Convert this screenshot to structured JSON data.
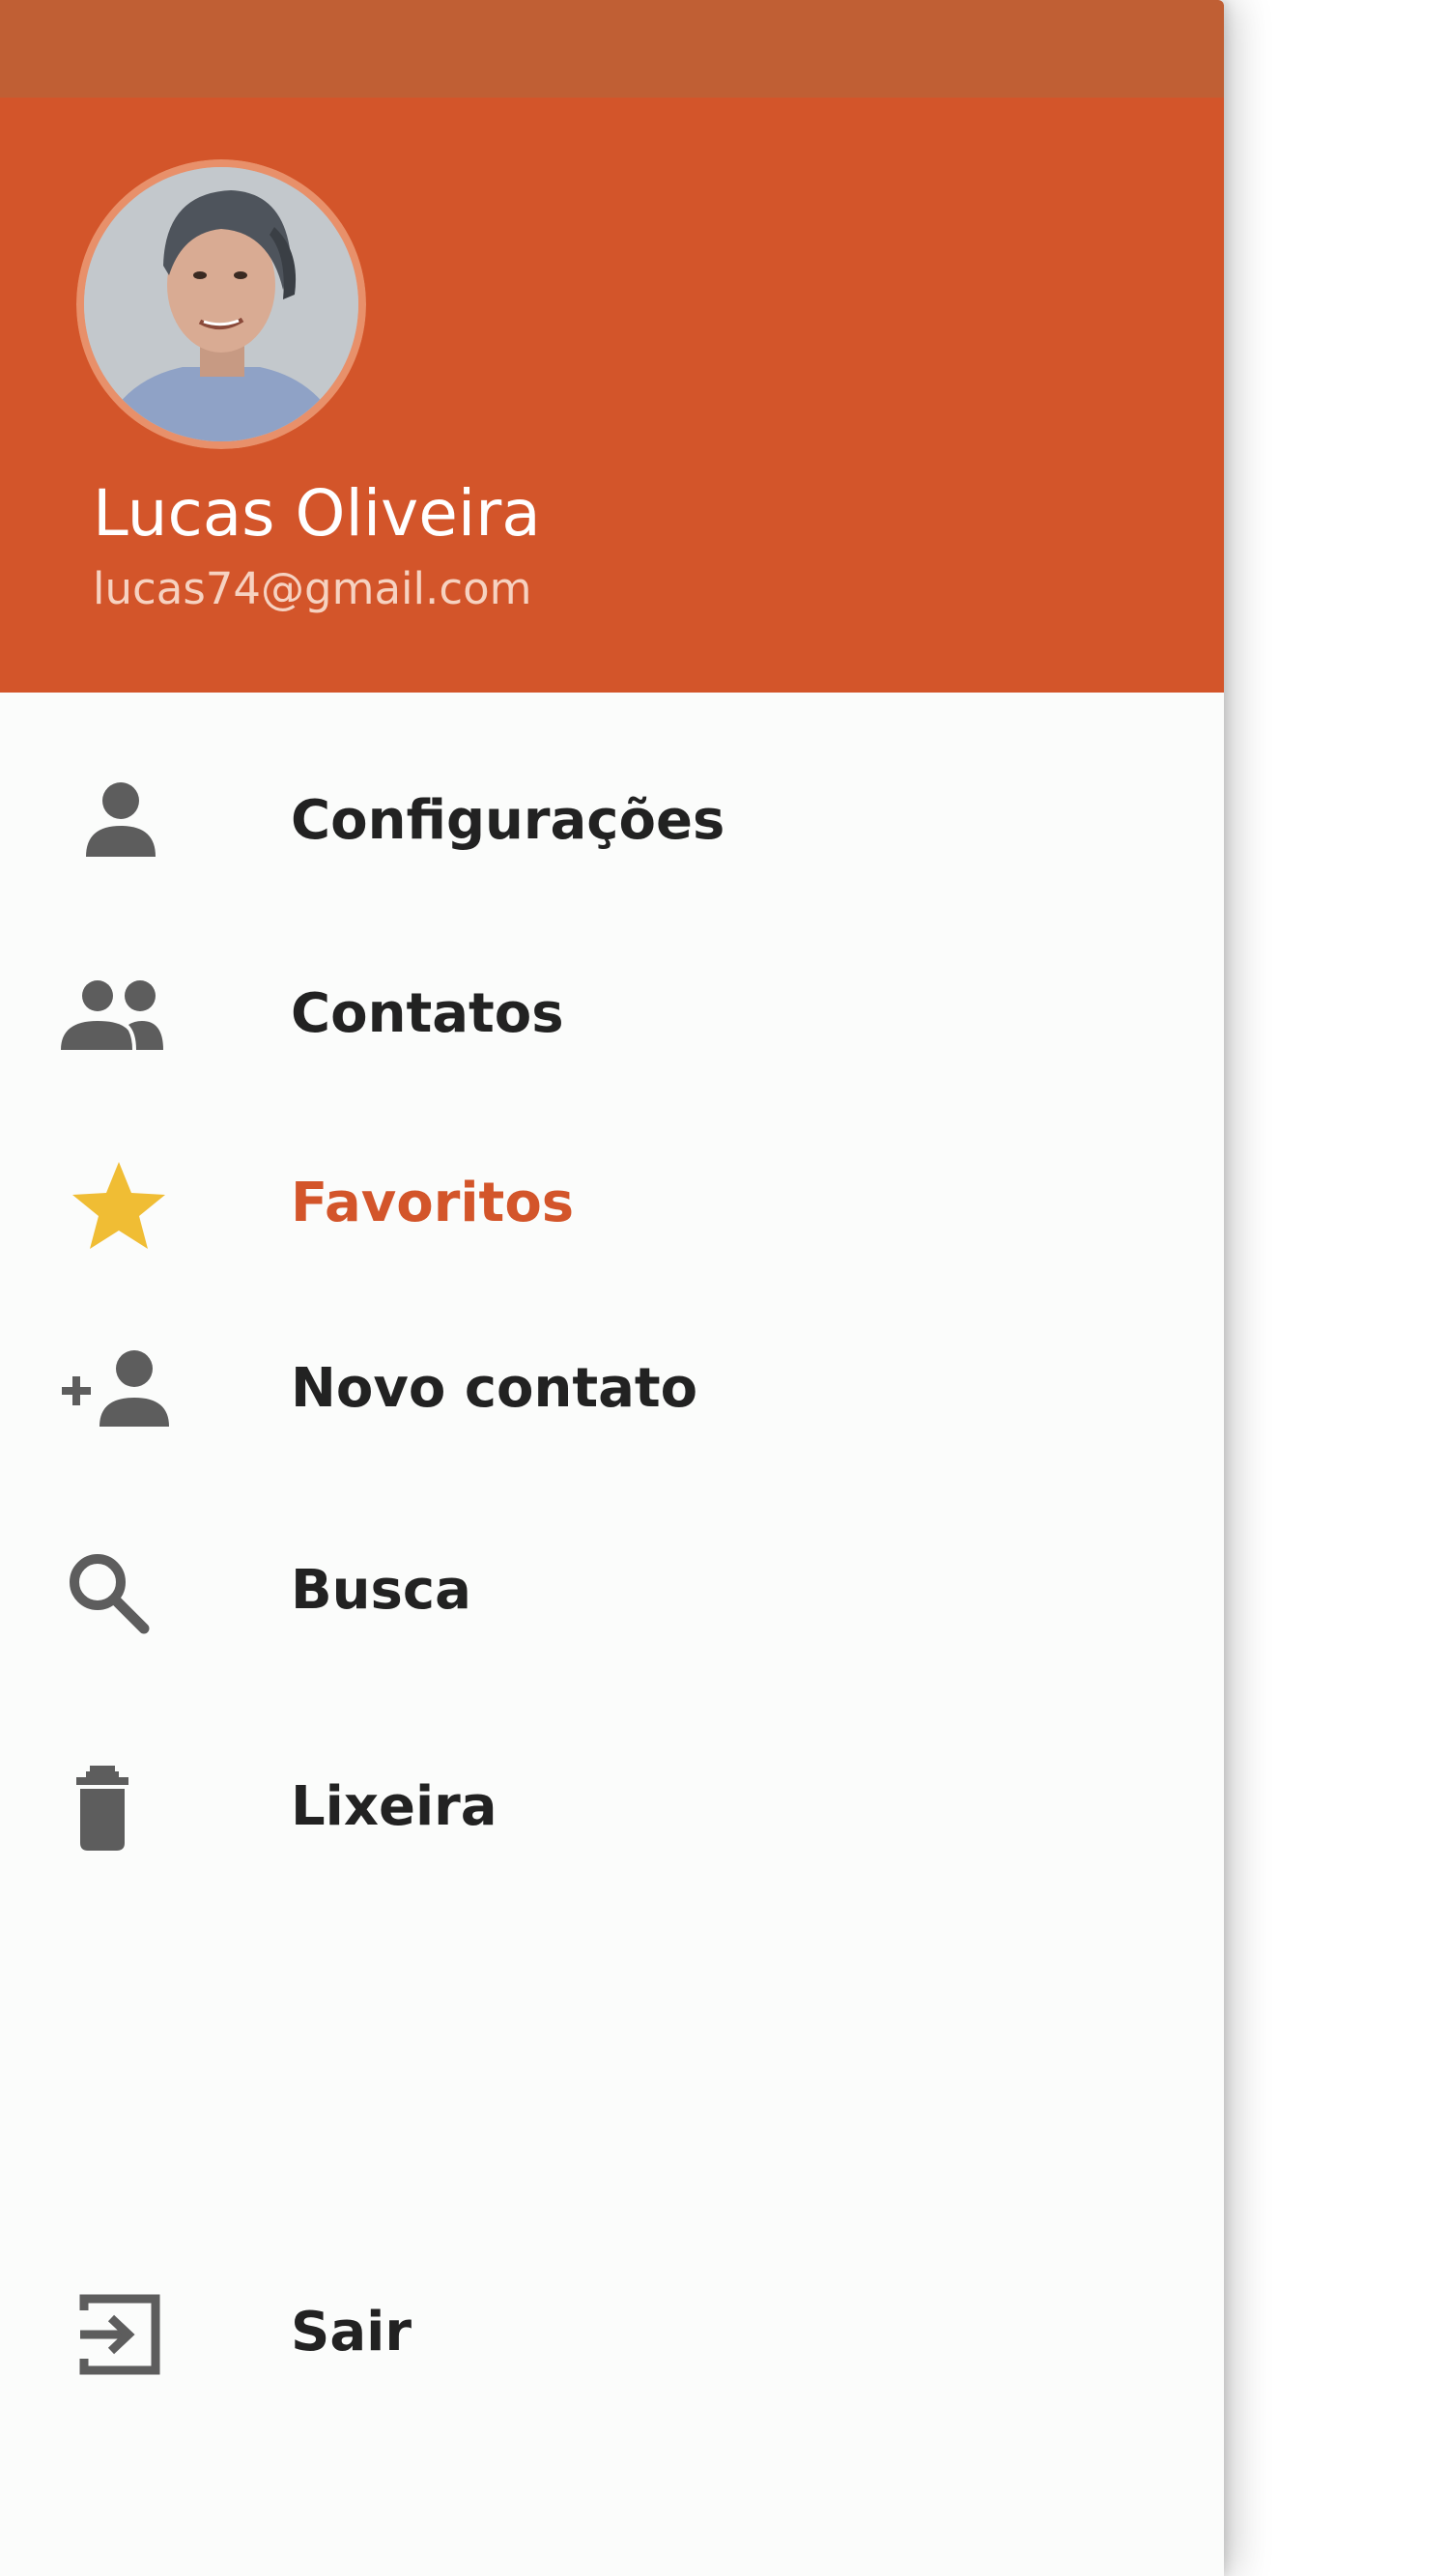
{
  "colors": {
    "status_bar": "#c05f34",
    "header": "#d3552a",
    "avatar_ring": "#e8906a",
    "icon": "#5d5d5d",
    "label": "#222222",
    "active_label": "#d3552a",
    "active_icon": "#f0bd34"
  },
  "user": {
    "name": "Lucas Oliveira",
    "email": "lucas74@gmail.com"
  },
  "menu": {
    "items": [
      {
        "label": "Configurações",
        "icon": "person-icon",
        "active": false
      },
      {
        "label": "Contatos",
        "icon": "people-icon",
        "active": false
      },
      {
        "label": "Favoritos",
        "icon": "star-icon",
        "active": true
      },
      {
        "label": "Novo contato",
        "icon": "person-add-icon",
        "active": false
      },
      {
        "label": "Busca",
        "icon": "search-icon",
        "active": false
      },
      {
        "label": "Lixeira",
        "icon": "trash-icon",
        "active": false
      },
      {
        "label": "Sair",
        "icon": "exit-icon",
        "active": false
      }
    ]
  }
}
